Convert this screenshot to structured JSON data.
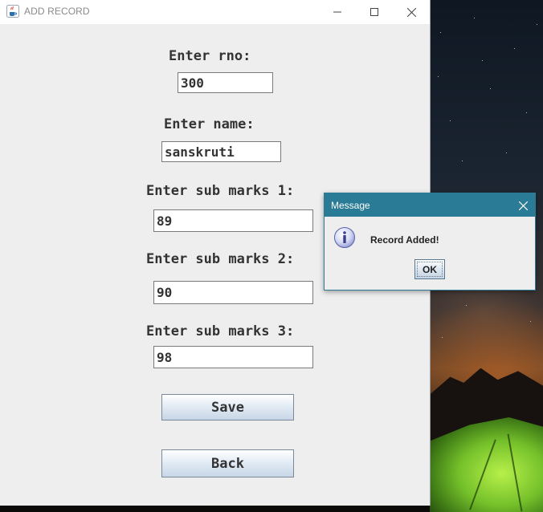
{
  "window": {
    "title": "ADD RECORD",
    "icon": "java-cup-icon"
  },
  "form": {
    "rno_label": "Enter rno:",
    "rno_value": "300",
    "name_label": "Enter name:",
    "name_value": "sanskruti",
    "marks1_label": "Enter sub marks 1:",
    "marks1_value": "89",
    "marks2_label": "Enter sub marks 2:",
    "marks2_value": "90",
    "marks3_label": "Enter sub marks 3:",
    "marks3_value": "98",
    "save_label": "Save",
    "back_label": "Back"
  },
  "dialog": {
    "title": "Message",
    "message": "Record Added!",
    "ok_label": "OK",
    "icon": "info-icon"
  },
  "colors": {
    "dialog_titlebar": "#2a7b96",
    "window_bg": "#eeeeee",
    "button_gradient_top": "#ffffff",
    "button_gradient_bottom": "#c7d6e6"
  }
}
